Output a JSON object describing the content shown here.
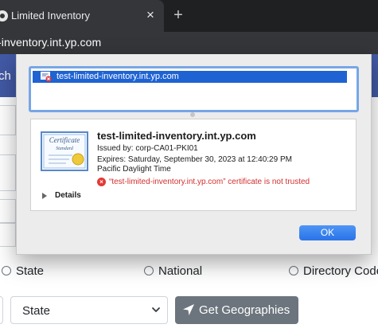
{
  "browser": {
    "tab_title": "Limited Inventory",
    "tab_close": "×",
    "new_tab": "+",
    "address": "-inventory.int.yp.com"
  },
  "page": {
    "nav_fragment": "ch",
    "radio_options": [
      "State",
      "National",
      "Directory Code"
    ],
    "state_select_value": "State",
    "get_geographies_label": "Get Geographies",
    "navbar_color": "#4259a5"
  },
  "dialog": {
    "list_item": "test-limited-inventory.int.yp.com",
    "cert_name": "test-limited-inventory.int.yp.com",
    "issued_by": "Issued by: corp-CA01-PKI01",
    "expires": "Expires: Saturday, September 30, 2023 at 12:40:29 PM",
    "timezone": "Pacific Daylight Time",
    "error": "“test-limited-inventory.int.yp.com” certificate is not trusted",
    "details_label": "Details",
    "ok_label": "OK",
    "icons": {
      "list": "certificate-warning-icon",
      "error": "error-x-icon",
      "details": "disclosure-triangle-icon",
      "preview": "certificate-icon"
    },
    "colors": {
      "selection": "#1f63d3",
      "error": "#d32f2f",
      "ok_button": "#2a73e8"
    }
  }
}
